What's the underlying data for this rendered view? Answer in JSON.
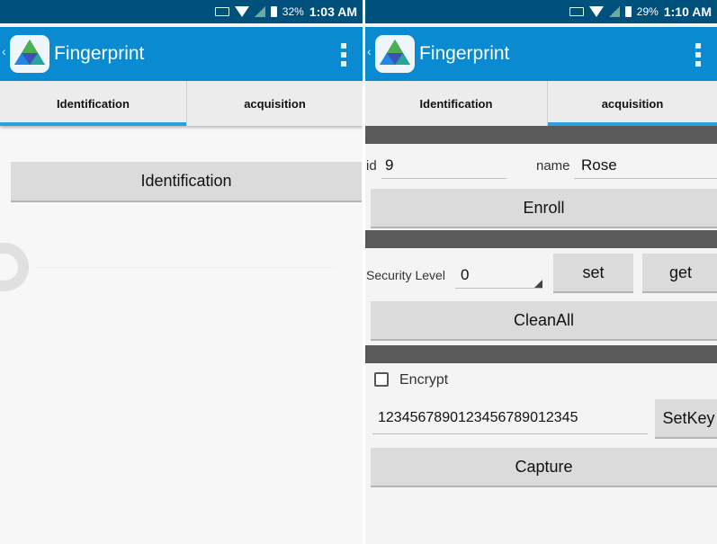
{
  "left": {
    "status": {
      "battery": "32%",
      "time": "1:03 AM"
    },
    "app_title": "Fingerprint",
    "tabs": [
      {
        "label": "Identification"
      },
      {
        "label": "acquisition"
      }
    ],
    "identification_button": "Identification"
  },
  "right": {
    "status": {
      "battery": "29%",
      "time": "1:10 AM"
    },
    "app_title": "Fingerprint",
    "tabs": [
      {
        "label": "Identification"
      },
      {
        "label": "acquisition"
      }
    ],
    "id_label": "id",
    "id_value": "9",
    "name_label": "name",
    "name_value": "Rose",
    "enroll_button": "Enroll",
    "security_label": "Security Level",
    "security_value": "0",
    "set_button": "set",
    "get_button": "get",
    "cleanall_button": "CleanAll",
    "encrypt_label": "Encrypt",
    "encrypt_checked": false,
    "key_value": "1234567890123456789012345",
    "setkey_button": "SetKey",
    "capture_button": "Capture"
  },
  "colors": {
    "statusbar": "#00507c",
    "appbar": "#0a8ad0",
    "tab_indicator": "#2aa0e0",
    "button": "#dbdbdb",
    "section_band": "#5a5a5a"
  }
}
